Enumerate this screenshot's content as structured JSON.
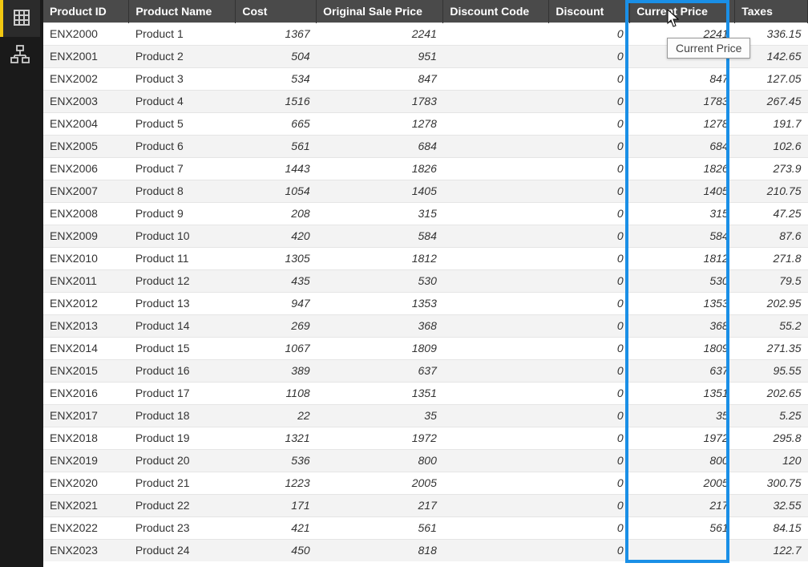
{
  "sidebar": {
    "items": [
      "data-view",
      "model-view"
    ]
  },
  "table": {
    "headers": [
      "Product ID",
      "Product Name",
      "Cost",
      "Original Sale Price",
      "Discount Code",
      "Discount",
      "Current Price",
      "Taxes"
    ],
    "rows": [
      {
        "pid": "ENX2000",
        "pname": "Product 1",
        "cost": "1367",
        "orig": "2241",
        "dcode": "",
        "disc": "0",
        "cur": "2241",
        "tax": "336.15"
      },
      {
        "pid": "ENX2001",
        "pname": "Product 2",
        "cost": "504",
        "orig": "951",
        "dcode": "",
        "disc": "0",
        "cur": "",
        "tax": "142.65"
      },
      {
        "pid": "ENX2002",
        "pname": "Product 3",
        "cost": "534",
        "orig": "847",
        "dcode": "",
        "disc": "0",
        "cur": "847",
        "tax": "127.05"
      },
      {
        "pid": "ENX2003",
        "pname": "Product 4",
        "cost": "1516",
        "orig": "1783",
        "dcode": "",
        "disc": "0",
        "cur": "1783",
        "tax": "267.45"
      },
      {
        "pid": "ENX2004",
        "pname": "Product 5",
        "cost": "665",
        "orig": "1278",
        "dcode": "",
        "disc": "0",
        "cur": "1278",
        "tax": "191.7"
      },
      {
        "pid": "ENX2005",
        "pname": "Product 6",
        "cost": "561",
        "orig": "684",
        "dcode": "",
        "disc": "0",
        "cur": "684",
        "tax": "102.6"
      },
      {
        "pid": "ENX2006",
        "pname": "Product 7",
        "cost": "1443",
        "orig": "1826",
        "dcode": "",
        "disc": "0",
        "cur": "1826",
        "tax": "273.9"
      },
      {
        "pid": "ENX2007",
        "pname": "Product 8",
        "cost": "1054",
        "orig": "1405",
        "dcode": "",
        "disc": "0",
        "cur": "1405",
        "tax": "210.75"
      },
      {
        "pid": "ENX2008",
        "pname": "Product 9",
        "cost": "208",
        "orig": "315",
        "dcode": "",
        "disc": "0",
        "cur": "315",
        "tax": "47.25"
      },
      {
        "pid": "ENX2009",
        "pname": "Product 10",
        "cost": "420",
        "orig": "584",
        "dcode": "",
        "disc": "0",
        "cur": "584",
        "tax": "87.6"
      },
      {
        "pid": "ENX2010",
        "pname": "Product 11",
        "cost": "1305",
        "orig": "1812",
        "dcode": "",
        "disc": "0",
        "cur": "1812",
        "tax": "271.8"
      },
      {
        "pid": "ENX2011",
        "pname": "Product 12",
        "cost": "435",
        "orig": "530",
        "dcode": "",
        "disc": "0",
        "cur": "530",
        "tax": "79.5"
      },
      {
        "pid": "ENX2012",
        "pname": "Product 13",
        "cost": "947",
        "orig": "1353",
        "dcode": "",
        "disc": "0",
        "cur": "1353",
        "tax": "202.95"
      },
      {
        "pid": "ENX2013",
        "pname": "Product 14",
        "cost": "269",
        "orig": "368",
        "dcode": "",
        "disc": "0",
        "cur": "368",
        "tax": "55.2"
      },
      {
        "pid": "ENX2014",
        "pname": "Product 15",
        "cost": "1067",
        "orig": "1809",
        "dcode": "",
        "disc": "0",
        "cur": "1809",
        "tax": "271.35"
      },
      {
        "pid": "ENX2015",
        "pname": "Product 16",
        "cost": "389",
        "orig": "637",
        "dcode": "",
        "disc": "0",
        "cur": "637",
        "tax": "95.55"
      },
      {
        "pid": "ENX2016",
        "pname": "Product 17",
        "cost": "1108",
        "orig": "1351",
        "dcode": "",
        "disc": "0",
        "cur": "1351",
        "tax": "202.65"
      },
      {
        "pid": "ENX2017",
        "pname": "Product 18",
        "cost": "22",
        "orig": "35",
        "dcode": "",
        "disc": "0",
        "cur": "35",
        "tax": "5.25"
      },
      {
        "pid": "ENX2018",
        "pname": "Product 19",
        "cost": "1321",
        "orig": "1972",
        "dcode": "",
        "disc": "0",
        "cur": "1972",
        "tax": "295.8"
      },
      {
        "pid": "ENX2019",
        "pname": "Product 20",
        "cost": "536",
        "orig": "800",
        "dcode": "",
        "disc": "0",
        "cur": "800",
        "tax": "120"
      },
      {
        "pid": "ENX2020",
        "pname": "Product 21",
        "cost": "1223",
        "orig": "2005",
        "dcode": "",
        "disc": "0",
        "cur": "2005",
        "tax": "300.75"
      },
      {
        "pid": "ENX2021",
        "pname": "Product 22",
        "cost": "171",
        "orig": "217",
        "dcode": "",
        "disc": "0",
        "cur": "217",
        "tax": "32.55"
      },
      {
        "pid": "ENX2022",
        "pname": "Product 23",
        "cost": "421",
        "orig": "561",
        "dcode": "",
        "disc": "0",
        "cur": "561",
        "tax": "84.15"
      },
      {
        "pid": "ENX2023",
        "pname": "Product 24",
        "cost": "450",
        "orig": "818",
        "dcode": "",
        "disc": "0",
        "cur": "",
        "tax": "122.7"
      }
    ]
  },
  "tooltip": {
    "text": "Current Price"
  }
}
